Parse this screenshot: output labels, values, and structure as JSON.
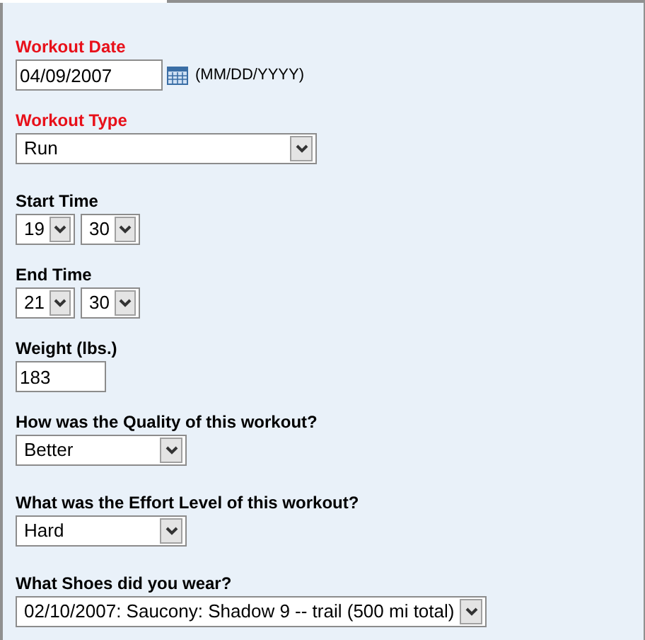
{
  "fields": [
    {
      "kind": "date",
      "label": "Workout Date",
      "required": true,
      "value": "04/09/2007",
      "hint": "(MM/DD/YYYY)"
    },
    {
      "kind": "long-select",
      "label": "Workout Type",
      "required": true,
      "value": "Run"
    },
    {
      "kind": "time",
      "label": "Start Time",
      "required": false,
      "hour": "19",
      "minute": "30"
    },
    {
      "kind": "time",
      "label": "End Time",
      "required": false,
      "hour": "21",
      "minute": "30"
    },
    {
      "kind": "text",
      "label": "Weight (lbs.)",
      "required": false,
      "value": "183"
    },
    {
      "kind": "select",
      "label": "How was the Quality of this workout?",
      "required": false,
      "value": "Better"
    },
    {
      "kind": "select",
      "label": "What was the Effort Level of this workout?",
      "required": false,
      "value": "Hard"
    },
    {
      "kind": "select",
      "label": "What Shoes did you wear?",
      "required": false,
      "value": "02/10/2007: Saucony: Shadow 9 -- trail (500 mi total)"
    }
  ]
}
